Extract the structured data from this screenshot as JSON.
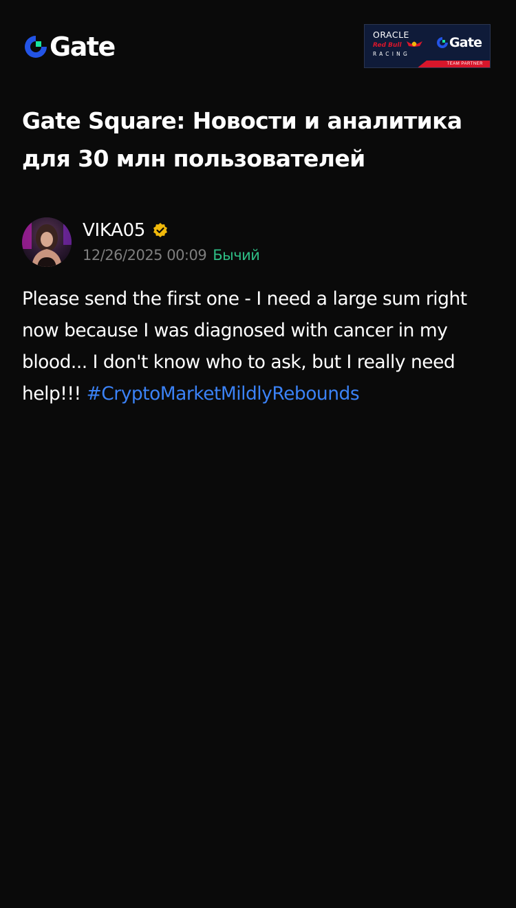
{
  "header": {
    "logo_text": "Gate",
    "partner": {
      "line1": "ORACLE",
      "line2": "Red Bull",
      "line3": "RACING",
      "brand": "Gate",
      "footer": "TEAM PARTNER"
    }
  },
  "page": {
    "title": "Gate Square: Новости и аналитика для 30 млн пользователей"
  },
  "post": {
    "author": "VIKA05",
    "verified": true,
    "timestamp": "12/26/2025 00:09",
    "sentiment": "Бычий",
    "body": "Please send the first one - I need a large sum right now because I was diagnosed with cancer in my blood... I don't know who to ask, but I really need help!!!",
    "hashtag": "#CryptoMarketMildlyRebounds"
  },
  "colors": {
    "background": "#0a0a0a",
    "text": "#ffffff",
    "timestamp": "#7e7e7e",
    "bullish": "#2ebd85",
    "hashtag": "#3b82f6",
    "verified_badge": "#f0b90b",
    "brand_blue": "#2354e6",
    "brand_green": "#17e5a1",
    "partner_navy": "#0f1b39",
    "partner_red": "#d8162b"
  }
}
